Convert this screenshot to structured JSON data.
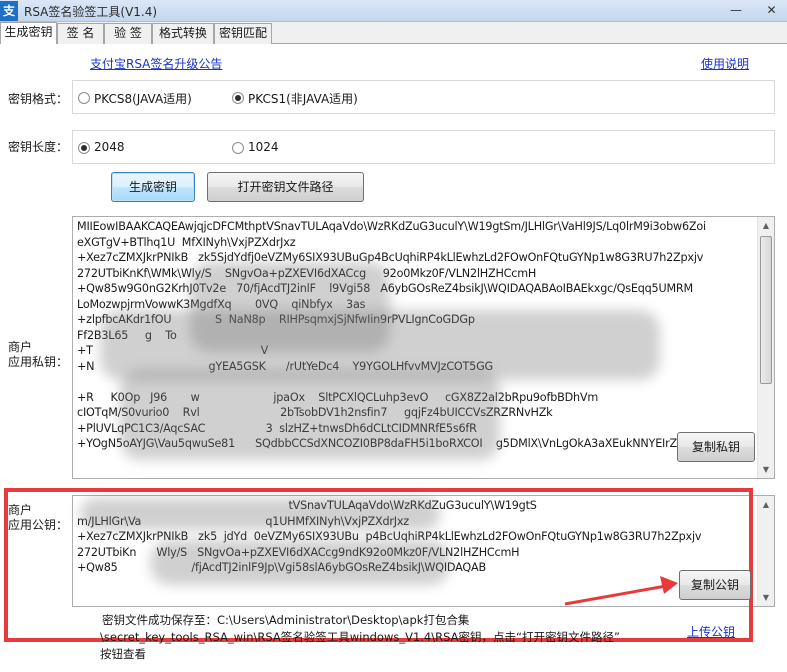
{
  "window": {
    "title": "RSA签名验签工具(V1.4)",
    "icon_glyph": "支",
    "minimize_glyph": "—",
    "close_glyph": "✕"
  },
  "tabs": [
    {
      "label": "生成密钥",
      "active": true
    },
    {
      "label": "签  名",
      "active": false
    },
    {
      "label": "验  签",
      "active": false
    },
    {
      "label": "格式转换",
      "active": false
    },
    {
      "label": "密钥匹配",
      "active": false
    }
  ],
  "links": {
    "announcement": "支付宝RSA签名升级公告",
    "help": "使用说明",
    "upload_public_key": "上传公钥"
  },
  "key_format": {
    "label": "密钥格式：",
    "options": [
      {
        "label": "PKCS8(JAVA适用)",
        "checked": false
      },
      {
        "label": "PKCS1(非JAVA适用)",
        "checked": true
      }
    ]
  },
  "key_length": {
    "label": "密钥长度：",
    "options": [
      {
        "label": "2048",
        "checked": true
      },
      {
        "label": "1024",
        "checked": false
      }
    ]
  },
  "buttons": {
    "generate": "生成密钥",
    "open_path": "打开密钥文件路径",
    "copy_private": "复制私钥",
    "copy_public": "复制公钥"
  },
  "private_key": {
    "label_line1": "商户",
    "label_line2": "应用私钥：",
    "text": "MIIEowIBAAKCAQEAwjqjcDFCMthptVSnavTULAqaVdo\\WzRKdZuG3uculY\\W19gtSm/JLHlGr\\VaHl9JS/Lq0lrM9i3obw6Zoi\neXGTgV+BTlhq1U  MfXINyh\\VxjPZXdrJxz\n+Xez7cZMXJkrPNIkB   zk5SjdYdfj0eVZMy6SIX93UBuGp4BcUqhiRP4kLlEwhzLd2FOwOnFQtuGYNp1w8G3RU7h2Zpxjv\n272UTbiKnKf\\WMk\\Wly/S    SNgvOa+pZXEVI6dXACcg     92o0Mkz0F/VLN2lHZHCcmH\n+Qw85w9G0nG2KrhJ0Tv2e   70/fjAcdTJ2inlF    l9Vgi58   A6ybGOsReZ4bsikJ\\WQIDAQABAoIBAEkxgc/QsEqq5UMRM\nLoMozwpjrmVowwK3MgdfXq       0VQ    qiNbfyx    3as\n+zlpfbcAKdr1fOU             S  NaN8p    RIHPsqmxjSjNfwIin9rPVLIgnCoGDGp\nFf2B3L65     g    To                                                              \n+T                                                  V                        \n+N                                  gYEA5GSK      /rUtYeDc4    Y9YGOLHfvvMVJzCOT5GG\n\n+R     K0Op   J96       w                      jpaOx    SltPCXlQCLuhp3evO     cGX8Z2al2bRpu9ofbBDhVm\ncIOTqM/S0vurio0    Rvl                        2bTsobDV1h2nsfin7     gqjFz4bUICCVsZRZRNvHZk\n+PlUVLqPC1C3/AqcSAC                  3  slzHZ+tnwsDh6dCLtCIDMNRfE5s6fR\n+YOgN5oAYJG\\Vau5qwuSe81      SQdbbCCSdXNCOZI0BP8daFH5i1boRXCOI    g5DMlX\\VnLgOkA3aXEukNNYEIrZ"
  },
  "public_key": {
    "label_line1": "商户",
    "label_line2": "应用公钥：",
    "text": "                                                               tVSnavTULAqaVdo\\WzRKdZuG3uculY\\W19gtS\nm/JLHlGr\\Va                                     q1UHMfXINyh\\VxjPZXdrJxz\n+Xez7cZMXJkrPNIkB   zk5  jdYd  0eVZMy6SIX93UBu  p4BcUqhiRP4kLlEwhzLd2FOwOnFQtuGYNp1w8G3RU7h2Zpxjv\n272UTbiKn      Wly/S   SNgvOa+pZXEVI6dXACcg9ndK92o0Mkz0F/VLN2lHZHCcmH\n+Qw85                      /fjAcdTJ2inlF9Jp\\Vgi58slA6ybGOsReZ4bsikJ\\WQIDAQAB"
  },
  "status": {
    "line1": "密钥文件成功保存至：C:\\Users\\Administrator\\Desktop\\apk打包合集",
    "line2": "\\secret_key_tools_RSA_win\\RSA签名验签工具windows_V1.4\\RSA密钥，点击“打开密钥文件路径”",
    "line3": "按钮查看"
  }
}
